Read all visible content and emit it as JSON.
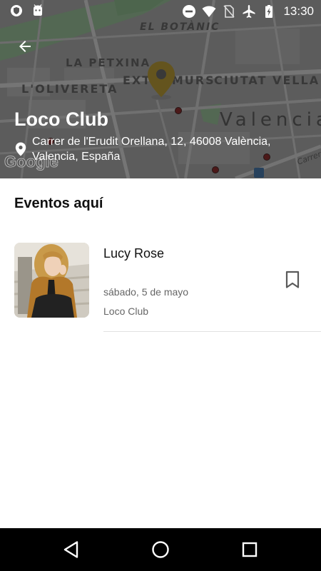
{
  "status_bar": {
    "time": "13:30",
    "left_icons": [
      "shield-icon",
      "android-icon"
    ],
    "right_icons": [
      "do-not-disturb-icon",
      "wifi-icon",
      "no-sim-icon",
      "airplane-mode-icon",
      "battery-charging-icon"
    ]
  },
  "map": {
    "labels": {
      "botanic": "EL BOTÀNIC",
      "petxina": "LA PETXINA",
      "olivereta": "L'OLIVERETA",
      "extramurs": "EXTRAMURS",
      "ciutat_vella": "CIUTAT VELLA",
      "valencia": "Valencia",
      "carrer": "Carrer"
    },
    "attribution": "Google",
    "pin_color": "#9a7d1b"
  },
  "header": {
    "back_icon": "arrow-back-icon",
    "title": "Loco Club",
    "address": "Carrer de l'Erudit Orellana, 12, 46008 València, Valencia, España"
  },
  "events_section": {
    "title": "Eventos aquí",
    "events": [
      {
        "name": "Lucy Rose",
        "date": "sábado, 5 de mayo",
        "venue": "Loco Club",
        "bookmark_icon": "bookmark-outline-icon"
      }
    ]
  },
  "nav_bar": {
    "icons": [
      "nav-back-icon",
      "nav-home-icon",
      "nav-recents-icon"
    ]
  },
  "colors": {
    "header_overlay": "#4a4a4a",
    "pin": "#9a7d1b",
    "title_text": "#111111",
    "secondary_text": "#666666",
    "nav_background": "#000000"
  }
}
